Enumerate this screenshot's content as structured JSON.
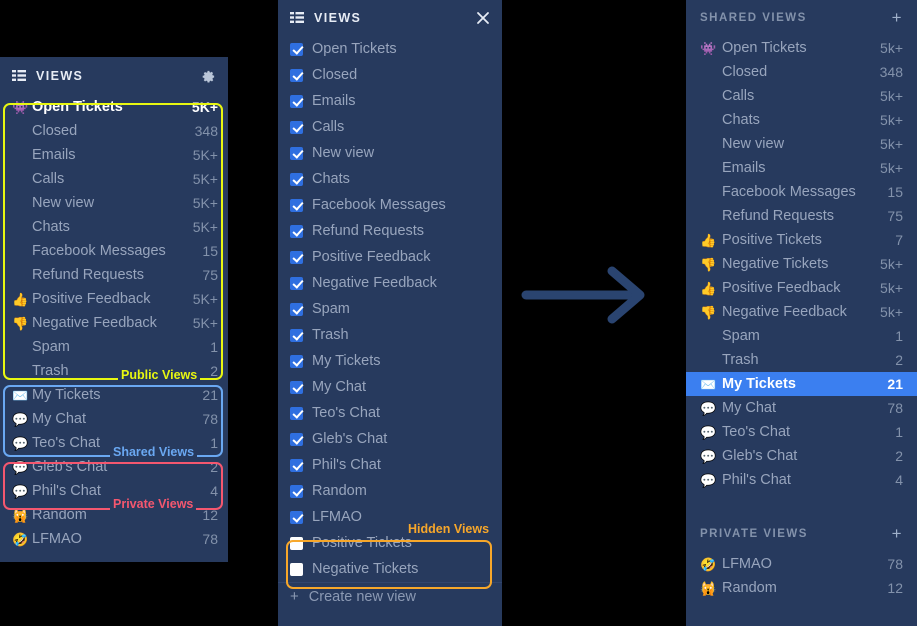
{
  "theme": {
    "page_bg": "#000000",
    "panel_bg": "#273a5e",
    "selected_row_bg": "#3b7ff0",
    "checkbox_on": "#2f6fe0",
    "annot_public": "#e8f711",
    "annot_shared": "#6aa8f2",
    "annot_private": "#f4576f",
    "annot_hidden": "#f7a72a",
    "arrow_color": "#2a4470"
  },
  "left_panel": {
    "header": {
      "title": "VIEWS",
      "list_icon": "list-icon",
      "gear_icon": "gear-icon"
    },
    "annotations": {
      "public": "Public Views",
      "shared": "Shared Views",
      "private": "Private Views"
    },
    "items": [
      {
        "icon": "👾",
        "icon_name": "alien-icon",
        "label": "Open Tickets",
        "count": "5K+",
        "active": true
      },
      {
        "icon": "",
        "icon_name": "",
        "label": "Closed",
        "count": "348",
        "active": false
      },
      {
        "icon": "",
        "icon_name": "",
        "label": "Emails",
        "count": "5K+",
        "active": false
      },
      {
        "icon": "",
        "icon_name": "",
        "label": "Calls",
        "count": "5K+",
        "active": false
      },
      {
        "icon": "",
        "icon_name": "",
        "label": "New view",
        "count": "5K+",
        "active": false
      },
      {
        "icon": "",
        "icon_name": "",
        "label": "Chats",
        "count": "5K+",
        "active": false
      },
      {
        "icon": "",
        "icon_name": "",
        "label": "Facebook Messages",
        "count": "15",
        "active": false
      },
      {
        "icon": "",
        "icon_name": "",
        "label": "Refund Requests",
        "count": "75",
        "active": false
      },
      {
        "icon": "👍",
        "icon_name": "thumbs-up-icon",
        "label": "Positive Feedback",
        "count": "5K+",
        "active": false
      },
      {
        "icon": "👎",
        "icon_name": "thumbs-down-icon",
        "label": "Negative Feedback",
        "count": "5K+",
        "active": false
      },
      {
        "icon": "",
        "icon_name": "",
        "label": "Spam",
        "count": "1",
        "active": false
      },
      {
        "icon": "",
        "icon_name": "",
        "label": "Trash",
        "count": "2",
        "active": false
      },
      {
        "icon": "✉️",
        "icon_name": "envelope-icon",
        "label": "My Tickets",
        "count": "21",
        "active": false
      },
      {
        "icon": "💬",
        "icon_name": "speech-bubble-icon",
        "label": "My Chat",
        "count": "78",
        "active": false
      },
      {
        "icon": "💬",
        "icon_name": "speech-bubble-icon",
        "label": "Teo's Chat",
        "count": "1",
        "active": false
      },
      {
        "icon": "💬",
        "icon_name": "speech-bubble-icon",
        "label": "Gleb's Chat",
        "count": "2",
        "active": false
      },
      {
        "icon": "💬",
        "icon_name": "speech-bubble-icon",
        "label": "Phil's Chat",
        "count": "4",
        "active": false
      },
      {
        "icon": "🙀",
        "icon_name": "screaming-cat-icon",
        "label": "Random",
        "count": "12",
        "active": false
      },
      {
        "icon": "🤣",
        "icon_name": "rofl-icon",
        "label": "LFMAO",
        "count": "78",
        "active": false
      }
    ]
  },
  "mid_panel": {
    "header": {
      "title": "VIEWS",
      "list_icon": "list-icon",
      "close_icon": "close-icon"
    },
    "annotation_hidden": "Hidden Views",
    "create_label": "Create new view",
    "create_plus": "+",
    "items": [
      {
        "label": "Open Tickets",
        "checked": true
      },
      {
        "label": "Closed",
        "checked": true
      },
      {
        "label": "Emails",
        "checked": true
      },
      {
        "label": "Calls",
        "checked": true
      },
      {
        "label": "New view",
        "checked": true
      },
      {
        "label": "Chats",
        "checked": true
      },
      {
        "label": "Facebook Messages",
        "checked": true
      },
      {
        "label": "Refund Requests",
        "checked": true
      },
      {
        "label": "Positive Feedback",
        "checked": true
      },
      {
        "label": "Negative Feedback",
        "checked": true
      },
      {
        "label": "Spam",
        "checked": true
      },
      {
        "label": "Trash",
        "checked": true
      },
      {
        "label": "My Tickets",
        "checked": true
      },
      {
        "label": "My Chat",
        "checked": true
      },
      {
        "label": "Teo's Chat",
        "checked": true
      },
      {
        "label": "Gleb's Chat",
        "checked": true
      },
      {
        "label": "Phil's Chat",
        "checked": true
      },
      {
        "label": "Random",
        "checked": true
      },
      {
        "label": "LFMAO",
        "checked": true
      },
      {
        "label": "Positive Tickets",
        "checked": false
      },
      {
        "label": "Negative Tickets",
        "checked": false
      }
    ]
  },
  "right_panel": {
    "shared_header": {
      "title": "SHARED VIEWS",
      "plus": "+"
    },
    "private_header": {
      "title": "PRIVATE VIEWS",
      "plus": "+"
    },
    "shared_items": [
      {
        "icon": "👾",
        "icon_name": "alien-icon",
        "label": "Open Tickets",
        "count": "5k+",
        "selected": false
      },
      {
        "icon": "",
        "icon_name": "",
        "label": "Closed",
        "count": "348",
        "selected": false
      },
      {
        "icon": "",
        "icon_name": "",
        "label": "Calls",
        "count": "5k+",
        "selected": false
      },
      {
        "icon": "",
        "icon_name": "",
        "label": "Chats",
        "count": "5k+",
        "selected": false
      },
      {
        "icon": "",
        "icon_name": "",
        "label": "New view",
        "count": "5k+",
        "selected": false
      },
      {
        "icon": "",
        "icon_name": "",
        "label": "Emails",
        "count": "5k+",
        "selected": false
      },
      {
        "icon": "",
        "icon_name": "",
        "label": "Facebook Messages",
        "count": "15",
        "selected": false
      },
      {
        "icon": "",
        "icon_name": "",
        "label": "Refund Requests",
        "count": "75",
        "selected": false
      },
      {
        "icon": "👍",
        "icon_name": "thumbs-up-icon",
        "label": "Positive Tickets",
        "count": "7",
        "selected": false
      },
      {
        "icon": "👎",
        "icon_name": "thumbs-down-icon",
        "label": "Negative Tickets",
        "count": "5k+",
        "selected": false
      },
      {
        "icon": "👍",
        "icon_name": "thumbs-up-icon",
        "label": "Positive Feedback",
        "count": "5k+",
        "selected": false
      },
      {
        "icon": "👎",
        "icon_name": "thumbs-down-icon",
        "label": "Negative Feedback",
        "count": "5k+",
        "selected": false
      },
      {
        "icon": "",
        "icon_name": "",
        "label": "Spam",
        "count": "1",
        "selected": false
      },
      {
        "icon": "",
        "icon_name": "",
        "label": "Trash",
        "count": "2",
        "selected": false
      },
      {
        "icon": "✉️",
        "icon_name": "envelope-icon",
        "label": "My Tickets",
        "count": "21",
        "selected": true
      },
      {
        "icon": "💬",
        "icon_name": "speech-bubble-icon",
        "label": "My Chat",
        "count": "78",
        "selected": false
      },
      {
        "icon": "💬",
        "icon_name": "speech-bubble-icon",
        "label": "Teo's Chat",
        "count": "1",
        "selected": false
      },
      {
        "icon": "💬",
        "icon_name": "speech-bubble-icon",
        "label": "Gleb's Chat",
        "count": "2",
        "selected": false
      },
      {
        "icon": "💬",
        "icon_name": "speech-bubble-icon",
        "label": "Phil's Chat",
        "count": "4",
        "selected": false
      }
    ],
    "private_items": [
      {
        "icon": "🤣",
        "icon_name": "rofl-icon",
        "label": "LFMAO",
        "count": "78",
        "selected": false
      },
      {
        "icon": "🙀",
        "icon_name": "screaming-cat-icon",
        "label": "Random",
        "count": "12",
        "selected": false
      }
    ]
  },
  "arrow": {
    "icon_name": "right-arrow-icon"
  }
}
